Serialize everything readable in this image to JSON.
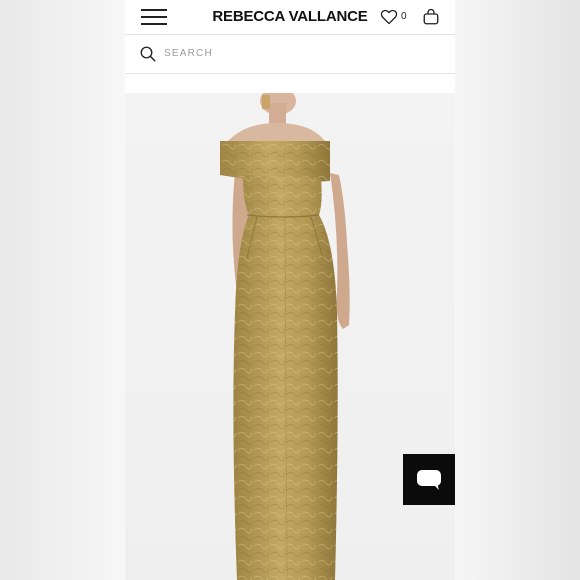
{
  "header": {
    "brand": "REBECCA VALLANCE",
    "wishlist_count": "0",
    "icons": [
      "menu-icon",
      "heart-icon",
      "bag-icon"
    ]
  },
  "search": {
    "placeholder": "SEARCH",
    "icon": "search-icon"
  },
  "product": {
    "image_alt": "Gold off-shoulder jacquard gown",
    "colors": {
      "gown_gold": "#b49a55",
      "skin": "#d9b8a0"
    }
  },
  "chat": {
    "icon": "chat-bubble-icon"
  }
}
